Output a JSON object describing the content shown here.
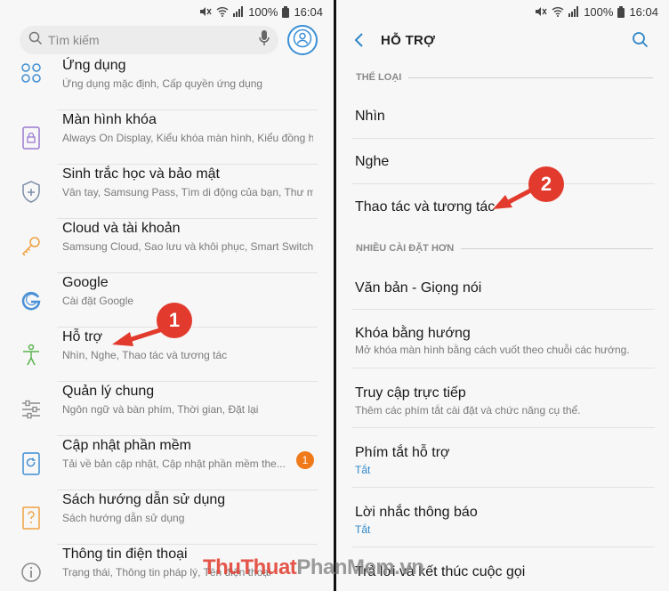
{
  "status": {
    "battery": "100%",
    "time": "16:04"
  },
  "left": {
    "search_placeholder": "Tìm kiếm",
    "items": [
      {
        "title": "Ứng dụng",
        "sub": "Ứng dụng mặc định, Cấp quyền ứng dụng",
        "icon": "apps-icon"
      },
      {
        "title": "Màn hình khóa",
        "sub": "Always On Display, Kiểu khóa màn hình, Kiểu đồng hồ",
        "icon": "lock-screen-icon"
      },
      {
        "title": "Sinh trắc học và bảo mật",
        "sub": "Vân tay, Samsung Pass, Tìm di động của bạn, Thư m...",
        "icon": "shield-icon"
      },
      {
        "title": "Cloud và tài khoản",
        "sub": "Samsung Cloud, Sao lưu và khôi phục, Smart Switch",
        "icon": "key-icon"
      },
      {
        "title": "Google",
        "sub": "Cài đặt Google",
        "icon": "google-icon"
      },
      {
        "title": "Hỗ trợ",
        "sub": "Nhìn, Nghe, Thao tác và tương tác",
        "icon": "accessibility-icon"
      },
      {
        "title": "Quản lý chung",
        "sub": "Ngôn ngữ và bàn phím, Thời gian, Đặt lại",
        "icon": "sliders-icon"
      },
      {
        "title": "Cập nhật phần mềm",
        "sub": "Tải về bản cập nhật, Cập nhật phần mềm the...",
        "icon": "update-icon",
        "badge": "1"
      },
      {
        "title": "Sách hướng dẫn sử dụng",
        "sub": "Sách hướng dẫn sử dụng",
        "icon": "manual-icon"
      },
      {
        "title": "Thông tin điện thoại",
        "sub": "Trạng thái, Thông tin pháp lý, Tên điện thoại",
        "icon": "info-icon"
      }
    ]
  },
  "right": {
    "title": "HỖ TRỢ",
    "section1": "THỂ LOẠI",
    "section2": "NHIỀU CÀI ĐẶT HƠN",
    "items": [
      {
        "title": "Nhìn"
      },
      {
        "title": "Nghe"
      },
      {
        "title": "Thao tác và tương tác"
      },
      {
        "title": "Văn bản - Giọng nói"
      },
      {
        "title": "Khóa bằng hướng",
        "sub": "Mở khóa màn hình bằng cách vuốt theo chuỗi các hướng."
      },
      {
        "title": "Truy cập trực tiếp",
        "sub": "Thêm các phím tắt cài đặt và chức năng cụ thể."
      },
      {
        "title": "Phím tắt hỗ trợ",
        "sub": "Tắt"
      },
      {
        "title": "Lời nhắc thông báo",
        "sub": "Tắt"
      },
      {
        "title": "Trả lời và kết thúc cuộc gọi"
      }
    ]
  },
  "callouts": {
    "one": "1",
    "two": "2"
  },
  "watermark": {
    "part1": "ThuThuat",
    "part2": "PhanMem",
    "part3": ".vn"
  },
  "colors": {
    "accent": "#2f86c8",
    "callout": "#e23a2c",
    "badge": "#f07a1a"
  }
}
